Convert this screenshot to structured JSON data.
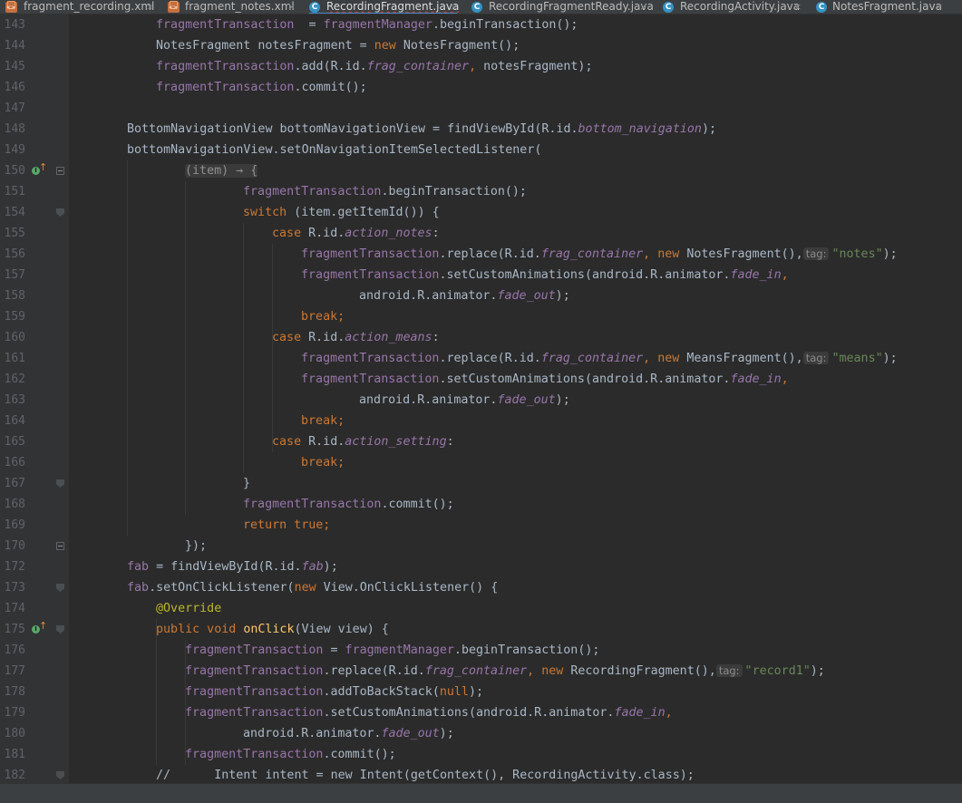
{
  "tabs": [
    {
      "label": "fragment_recording.xml",
      "icon": "xml-file-icon",
      "active": false
    },
    {
      "label": "fragment_notes.xml",
      "icon": "xml-file-icon",
      "active": false
    },
    {
      "label": "RecordingFragment.java",
      "icon": "java-class-icon",
      "active": true
    },
    {
      "label": "RecordingFragmentReady.java",
      "icon": "java-class-icon",
      "active": false
    },
    {
      "label": "RecordingActivity.java",
      "icon": "java-class-icon",
      "active": false
    },
    {
      "label": "NotesFragment.java",
      "icon": "java-class-icon",
      "active": false
    }
  ],
  "tab_close_glyph": "×",
  "colors": {
    "background": "#2b2b2b",
    "gutter": "#313335",
    "keyword": "#cc7832",
    "field": "#9876aa",
    "string": "#6a8759",
    "annotation": "#bbb529",
    "method_declaration": "#ffc66d",
    "plain": "#a9b7c6"
  },
  "code": {
    "lines": [
      {
        "n": "143",
        "segs": [
          [
            "fld",
            "fragmentTransaction"
          ],
          [
            "",
            "  = "
          ],
          [
            "fld",
            "fragmentManager"
          ],
          [
            "",
            ".beginTransaction();"
          ]
        ]
      },
      {
        "n": "144",
        "segs": [
          [
            "",
            "NotesFragment notesFragment = "
          ],
          [
            "kw",
            "new"
          ],
          [
            "",
            " NotesFragment();"
          ]
        ]
      },
      {
        "n": "145",
        "segs": [
          [
            "fld",
            "fragmentTransaction"
          ],
          [
            "",
            ".add(R.id."
          ],
          [
            "ifld",
            "frag_container"
          ],
          [
            "kw",
            ","
          ],
          [
            "",
            " notesFragment);"
          ]
        ]
      },
      {
        "n": "146",
        "segs": [
          [
            "fld",
            "fragmentTransaction"
          ],
          [
            "",
            ".commit();"
          ]
        ]
      },
      {
        "n": "147",
        "segs": []
      },
      {
        "n": "148",
        "segs": [
          [
            "",
            "BottomNavigationView bottomNavigationView = findViewById(R.id."
          ],
          [
            "ifld",
            "bottom_navigation"
          ],
          [
            "",
            ");"
          ]
        ]
      },
      {
        "n": "149",
        "segs": [
          [
            "",
            "bottomNavigationView.setOnNavigationItemSelectedListener("
          ]
        ]
      },
      {
        "n": "150",
        "segs": [
          [
            "lambda",
            "(item) → {"
          ]
        ]
      },
      {
        "n": "151",
        "segs": [
          [
            "fld",
            "fragmentTransaction"
          ],
          [
            "",
            ".beginTransaction();"
          ]
        ]
      },
      {
        "n": "154",
        "segs": [
          [
            "kw",
            "switch"
          ],
          [
            "",
            " (item.getItemId()) {"
          ]
        ]
      },
      {
        "n": "155",
        "segs": [
          [
            "kw",
            "case"
          ],
          [
            "",
            " R.id."
          ],
          [
            "ifld",
            "action_notes"
          ],
          [
            "",
            ":"
          ]
        ]
      },
      {
        "n": "156",
        "segs": [
          [
            "fld",
            "fragmentTransaction"
          ],
          [
            "",
            ".replace(R.id."
          ],
          [
            "ifld",
            "frag_container"
          ],
          [
            "kw",
            ","
          ],
          [
            "kw",
            " new"
          ],
          [
            "",
            " NotesFragment(),"
          ],
          [
            "hint",
            "tag:"
          ],
          [
            "str",
            "\"notes\""
          ],
          [
            "",
            ");"
          ]
        ]
      },
      {
        "n": "157",
        "segs": [
          [
            "fld",
            "fragmentTransaction"
          ],
          [
            "",
            ".setCustomAnimations(android.R.animator."
          ],
          [
            "ifld",
            "fade_in"
          ],
          [
            "kw",
            ","
          ]
        ]
      },
      {
        "n": "158",
        "segs": [
          [
            "",
            "android.R.animator."
          ],
          [
            "ifld",
            "fade_out"
          ],
          [
            "",
            ");"
          ]
        ]
      },
      {
        "n": "159",
        "segs": [
          [
            "kw",
            "break;"
          ]
        ]
      },
      {
        "n": "160",
        "segs": [
          [
            "kw",
            "case"
          ],
          [
            "",
            " R.id."
          ],
          [
            "ifld",
            "action_means"
          ],
          [
            "",
            ":"
          ]
        ]
      },
      {
        "n": "161",
        "segs": [
          [
            "fld",
            "fragmentTransaction"
          ],
          [
            "",
            ".replace(R.id."
          ],
          [
            "ifld",
            "frag_container"
          ],
          [
            "kw",
            ","
          ],
          [
            "kw",
            " new"
          ],
          [
            "",
            " MeansFragment(),"
          ],
          [
            "hint",
            "tag:"
          ],
          [
            "str",
            "\"means\""
          ],
          [
            "",
            ");"
          ]
        ]
      },
      {
        "n": "162",
        "segs": [
          [
            "fld",
            "fragmentTransaction"
          ],
          [
            "",
            ".setCustomAnimations(android.R.animator."
          ],
          [
            "ifld",
            "fade_in"
          ],
          [
            "kw",
            ","
          ]
        ]
      },
      {
        "n": "163",
        "segs": [
          [
            "",
            "android.R.animator."
          ],
          [
            "ifld",
            "fade_out"
          ],
          [
            "",
            ");"
          ]
        ]
      },
      {
        "n": "164",
        "segs": [
          [
            "kw",
            "break;"
          ]
        ]
      },
      {
        "n": "165",
        "segs": [
          [
            "kw",
            "case"
          ],
          [
            "",
            " R.id."
          ],
          [
            "ifld",
            "action_setting"
          ],
          [
            "",
            ":"
          ]
        ]
      },
      {
        "n": "166",
        "segs": [
          [
            "kw",
            "break;"
          ]
        ]
      },
      {
        "n": "167",
        "segs": [
          [
            "",
            "}"
          ]
        ]
      },
      {
        "n": "168",
        "segs": [
          [
            "fld",
            "fragmentTransaction"
          ],
          [
            "",
            ".commit();"
          ]
        ]
      },
      {
        "n": "169",
        "segs": [
          [
            "kw",
            "return true;"
          ]
        ]
      },
      {
        "n": "170",
        "segs": [
          [
            "",
            "});"
          ]
        ]
      },
      {
        "n": "172",
        "segs": [
          [
            "fld",
            "fab"
          ],
          [
            "",
            " = findViewById(R.id."
          ],
          [
            "ifld",
            "fab"
          ],
          [
            "",
            ");"
          ]
        ]
      },
      {
        "n": "173",
        "segs": [
          [
            "fld",
            "fab"
          ],
          [
            "",
            ".setOnClickListener("
          ],
          [
            "kw",
            "new"
          ],
          [
            "",
            " View.OnClickListener() {"
          ]
        ]
      },
      {
        "n": "174",
        "segs": [
          [
            "ann",
            "@Override"
          ]
        ]
      },
      {
        "n": "175",
        "segs": [
          [
            "kw",
            "public void"
          ],
          [
            "",
            " "
          ],
          [
            "mdecl",
            "onClick"
          ],
          [
            "",
            "(View view) {"
          ]
        ]
      },
      {
        "n": "176",
        "segs": [
          [
            "fld",
            "fragmentTransaction"
          ],
          [
            "",
            ""
          ],
          [
            "",
            " = "
          ],
          [
            "fld",
            "fragmentManager"
          ],
          [
            "",
            ".beginTransaction();"
          ]
        ]
      },
      {
        "n": "177",
        "segs": [
          [
            "fld",
            "fragmentTransaction"
          ],
          [
            "",
            ".replace(R.id."
          ],
          [
            "ifld",
            "frag_container"
          ],
          [
            "kw",
            ","
          ],
          [
            "kw",
            " new"
          ],
          [
            "",
            " RecordingFragment(),"
          ],
          [
            "hint",
            "tag:"
          ],
          [
            "str",
            "\"record1\""
          ],
          [
            "",
            ");"
          ]
        ]
      },
      {
        "n": "178",
        "segs": [
          [
            "fld",
            "fragmentTransaction"
          ],
          [
            "",
            ".addToBackStack("
          ],
          [
            "kw",
            "null"
          ],
          [
            "",
            ");"
          ]
        ]
      },
      {
        "n": "179",
        "segs": [
          [
            "fld",
            "fragmentTransaction"
          ],
          [
            "",
            ".setCustomAnimations(android.R.animator."
          ],
          [
            "ifld",
            "fade_in"
          ],
          [
            "kw",
            ","
          ]
        ]
      },
      {
        "n": "180",
        "segs": [
          [
            "",
            "android.R.animator."
          ],
          [
            "ifld",
            "fade_out"
          ],
          [
            "",
            ");"
          ]
        ]
      },
      {
        "n": "181",
        "segs": [
          [
            "fld",
            "fragmentTransaction"
          ],
          [
            "",
            ".commit();"
          ]
        ]
      },
      {
        "n": "182",
        "segs": [
          [
            "",
            "//      Intent intent = new Intent(getContext(), RecordingActivity.class);"
          ]
        ]
      }
    ]
  }
}
